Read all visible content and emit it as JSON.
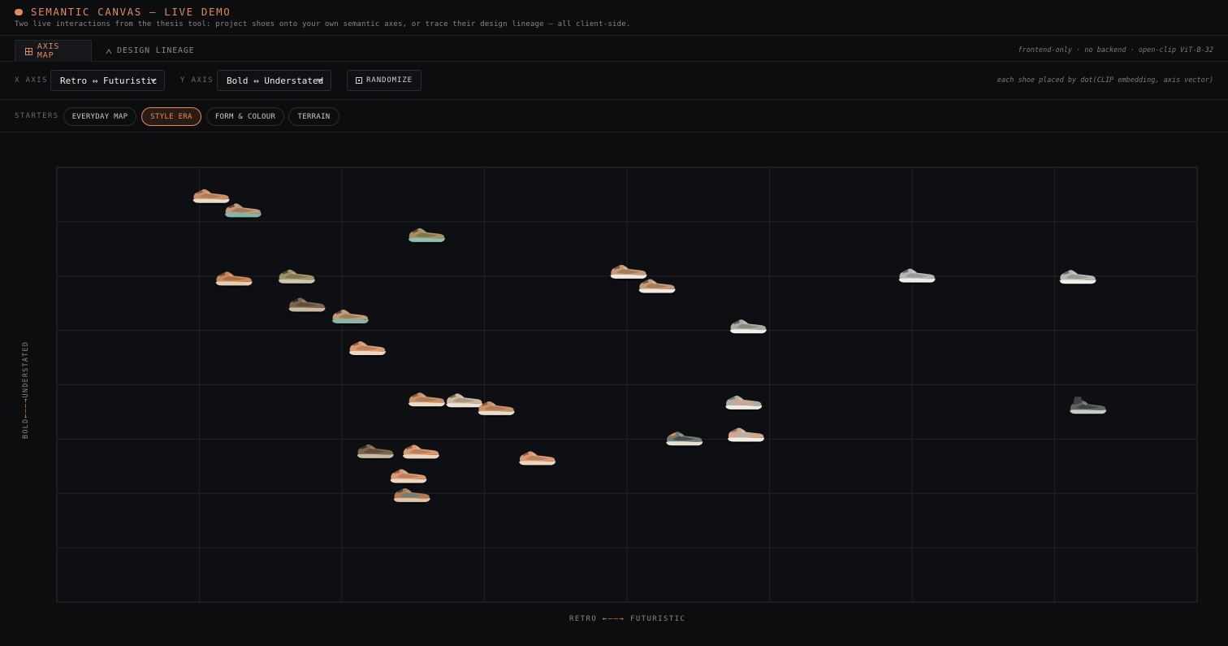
{
  "header": {
    "title": "SEMANTIC CANVAS — LIVE DEMO",
    "subtitle": "Two live interactions from the thesis tool: project shoes onto your own semantic axes, or trace their design lineage — all client-side."
  },
  "tabs": [
    {
      "label": "AXIS MAP",
      "icon": "grid-icon",
      "active": true
    },
    {
      "label": "DESIGN LINEAGE",
      "icon": "tree-icon",
      "active": false
    }
  ],
  "tabs_meta": "frontend-only · no backend · open-clip ViT-B-32",
  "axes": {
    "x_label": "X AXIS",
    "x_value": "Retro ⇔ Futuristic",
    "y_label": "Y AXIS",
    "y_value": "Bold ⇔ Understated",
    "randomize_label": "RANDOMIZE",
    "hint": "each shoe placed by dot(CLIP embedding, axis vector)"
  },
  "starters": {
    "label": "STARTERS",
    "items": [
      {
        "label": "EVERYDAY MAP",
        "active": false
      },
      {
        "label": "STYLE ERA",
        "active": true
      },
      {
        "label": "FORM & COLOUR",
        "active": false
      },
      {
        "label": "TERRAIN",
        "active": false
      }
    ]
  },
  "plot": {
    "y_axis_left": "BOLD",
    "y_axis_arrow": "←——→",
    "y_axis_right": "UNDERSTATED",
    "x_axis_left": "RETRO",
    "x_axis_arrow": "←——→",
    "x_axis_right": "FUTURISTIC"
  },
  "colors": {
    "accent": "#e08a5e",
    "background": "#0c0d0f",
    "grid": "#1f2226"
  },
  "chart_data": {
    "type": "scatter",
    "xlim": [
      0,
      1
    ],
    "ylim": [
      0,
      1
    ],
    "grid": true,
    "grid_divisions": {
      "x": 8,
      "y": 8
    },
    "points": [
      {
        "x": 0.135,
        "y": 0.935,
        "tone": "tan"
      },
      {
        "x": 0.163,
        "y": 0.902,
        "tone": "tan-teal"
      },
      {
        "x": 0.324,
        "y": 0.845,
        "tone": "olive-teal"
      },
      {
        "x": 0.155,
        "y": 0.745,
        "tone": "tan-sandal"
      },
      {
        "x": 0.21,
        "y": 0.75,
        "tone": "olive"
      },
      {
        "x": 0.219,
        "y": 0.685,
        "tone": "brown"
      },
      {
        "x": 0.257,
        "y": 0.658,
        "tone": "tan-teal"
      },
      {
        "x": 0.272,
        "y": 0.585,
        "tone": "peach"
      },
      {
        "x": 0.324,
        "y": 0.467,
        "tone": "tan"
      },
      {
        "x": 0.357,
        "y": 0.465,
        "tone": "beige"
      },
      {
        "x": 0.385,
        "y": 0.447,
        "tone": "tan"
      },
      {
        "x": 0.279,
        "y": 0.348,
        "tone": "brown"
      },
      {
        "x": 0.319,
        "y": 0.347,
        "tone": "peach"
      },
      {
        "x": 0.308,
        "y": 0.291,
        "tone": "peach"
      },
      {
        "x": 0.311,
        "y": 0.247,
        "tone": "multi"
      },
      {
        "x": 0.421,
        "y": 0.332,
        "tone": "peach"
      },
      {
        "x": 0.501,
        "y": 0.761,
        "tone": "tan-white"
      },
      {
        "x": 0.526,
        "y": 0.728,
        "tone": "tan-white"
      },
      {
        "x": 0.606,
        "y": 0.635,
        "tone": "grey-white"
      },
      {
        "x": 0.55,
        "y": 0.377,
        "tone": "grey-orange"
      },
      {
        "x": 0.602,
        "y": 0.46,
        "tone": "grey-peach"
      },
      {
        "x": 0.604,
        "y": 0.386,
        "tone": "peach-white"
      },
      {
        "x": 0.754,
        "y": 0.752,
        "tone": "silver"
      },
      {
        "x": 0.895,
        "y": 0.749,
        "tone": "silver"
      },
      {
        "x": 0.904,
        "y": 0.45,
        "tone": "dark-grey"
      }
    ]
  }
}
